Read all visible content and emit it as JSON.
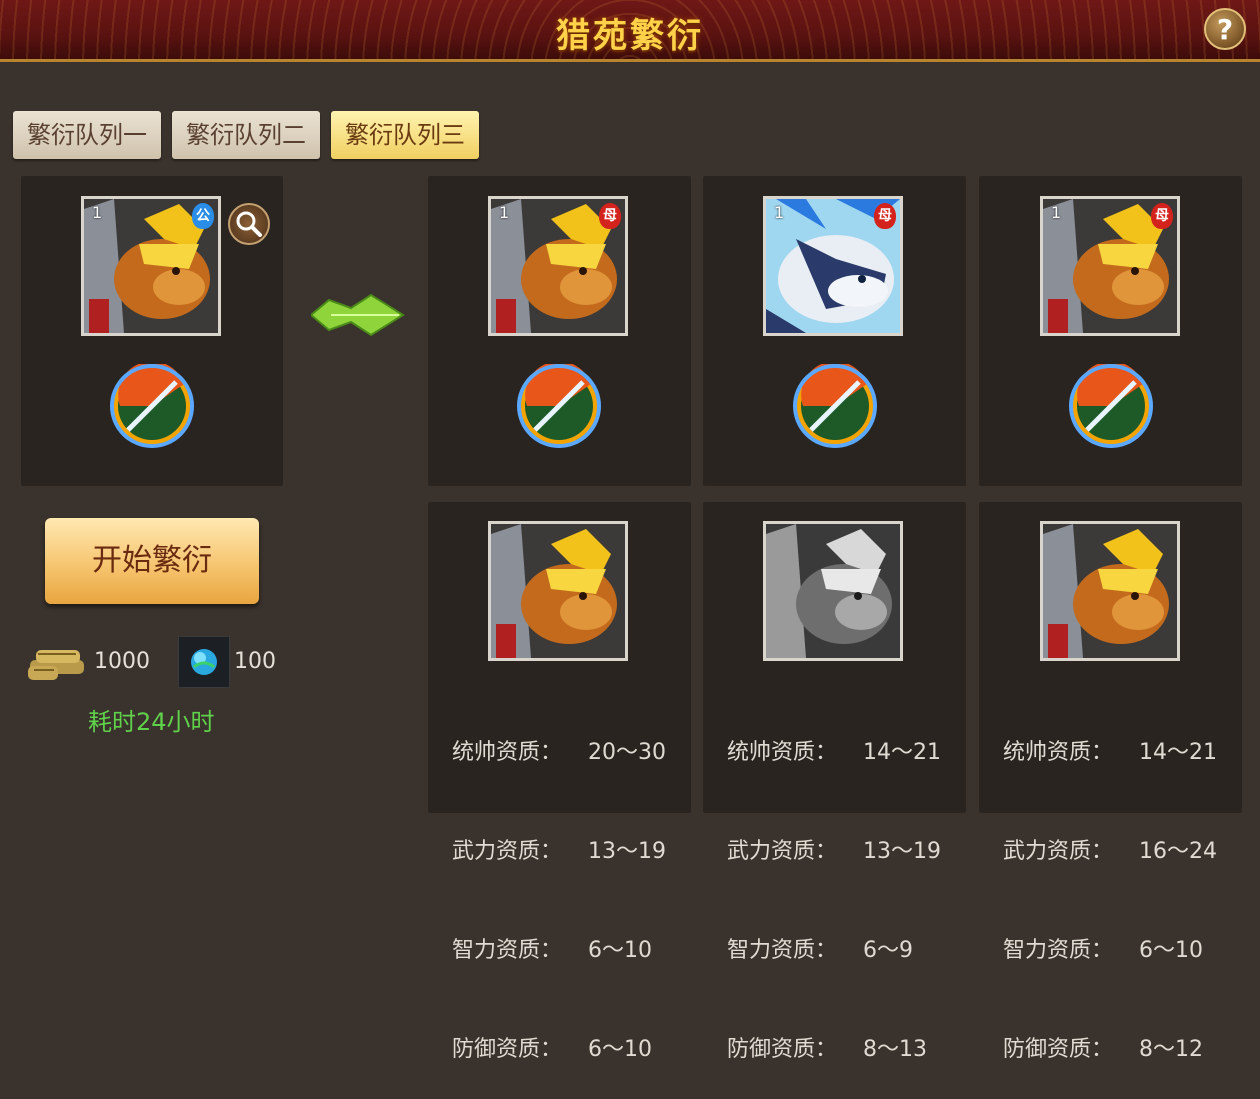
{
  "title": "猎苑繁衍",
  "help_icon": "question-icon",
  "tabs": [
    {
      "label": "繁衍队列一",
      "active": false
    },
    {
      "label": "繁衍队列二",
      "active": false
    },
    {
      "label": "繁衍队列三",
      "active": true
    }
  ],
  "parent": {
    "level": "1",
    "gender": "公",
    "icon": "golden-bear-icon"
  },
  "offspring": [
    {
      "level": "1",
      "gender": "母",
      "icon": "golden-bear-icon"
    },
    {
      "level": "1",
      "gender": "母",
      "icon": "frost-wolf-icon"
    },
    {
      "level": "1",
      "gender": "母",
      "icon": "golden-bear-icon"
    }
  ],
  "results": [
    {
      "icon": "golden-bear-icon",
      "grayscale": false,
      "stats": [
        {
          "k": "统帅资质：",
          "v": "20～30"
        },
        {
          "k": "武力资质：",
          "v": "13～19"
        },
        {
          "k": "智力资质：",
          "v": "6～10"
        },
        {
          "k": "防御资质：",
          "v": "6～10"
        }
      ]
    },
    {
      "icon": "gray-bear-icon",
      "grayscale": true,
      "stats": [
        {
          "k": "统帅资质：",
          "v": "14～21"
        },
        {
          "k": "武力资质：",
          "v": "13～19"
        },
        {
          "k": "智力资质：",
          "v": "6～9"
        },
        {
          "k": "防御资质：",
          "v": "8～13"
        }
      ]
    },
    {
      "icon": "golden-bear-icon",
      "grayscale": false,
      "stats": [
        {
          "k": "统帅资质：",
          "v": "14～21"
        },
        {
          "k": "武力资质：",
          "v": "16～24"
        },
        {
          "k": "智力资质：",
          "v": "6～10"
        },
        {
          "k": "防御资质：",
          "v": "8～12"
        }
      ]
    }
  ],
  "start_button": "开始繁衍",
  "costs": [
    {
      "icon": "grain-sacks-icon",
      "amount": "1000"
    },
    {
      "icon": "blue-orb-icon",
      "amount": "100"
    }
  ],
  "duration": "耗时24小时",
  "colors": {
    "title": "#ffd24a",
    "duration": "#5fd14a",
    "active_tab": "#f0cf60"
  }
}
